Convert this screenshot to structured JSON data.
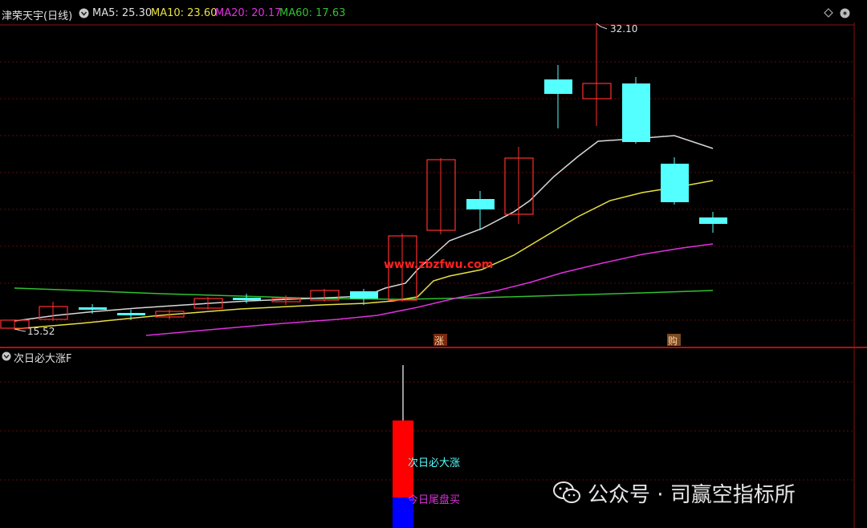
{
  "header": {
    "stock_title": "津荣天宇(日线)",
    "ma5": "MA5: 25.30",
    "ma10": "MA10: 23.60",
    "ma20": "MA20: 20.17",
    "ma60": "MA60: 17.63"
  },
  "colors": {
    "up": "#ff3030",
    "down": "#54ffff",
    "ma5": "#e0e0e0",
    "ma10": "#e8e040",
    "ma20": "#e030e0",
    "ma60": "#30c030",
    "divider": "#b01010"
  },
  "main_chart": {
    "high_label": "32.10",
    "low_label": "15.52",
    "watermark_url": "www.zbzfwu.com",
    "signal_zhang": "涨",
    "signal_gou": "购"
  },
  "indicator": {
    "title": "次日必大涨F",
    "label_next_day": "次日必大涨",
    "label_buy_close": "今日尾盘买"
  },
  "overlay": {
    "watermark_text": "公众号 · 司赢空指标所"
  }
}
